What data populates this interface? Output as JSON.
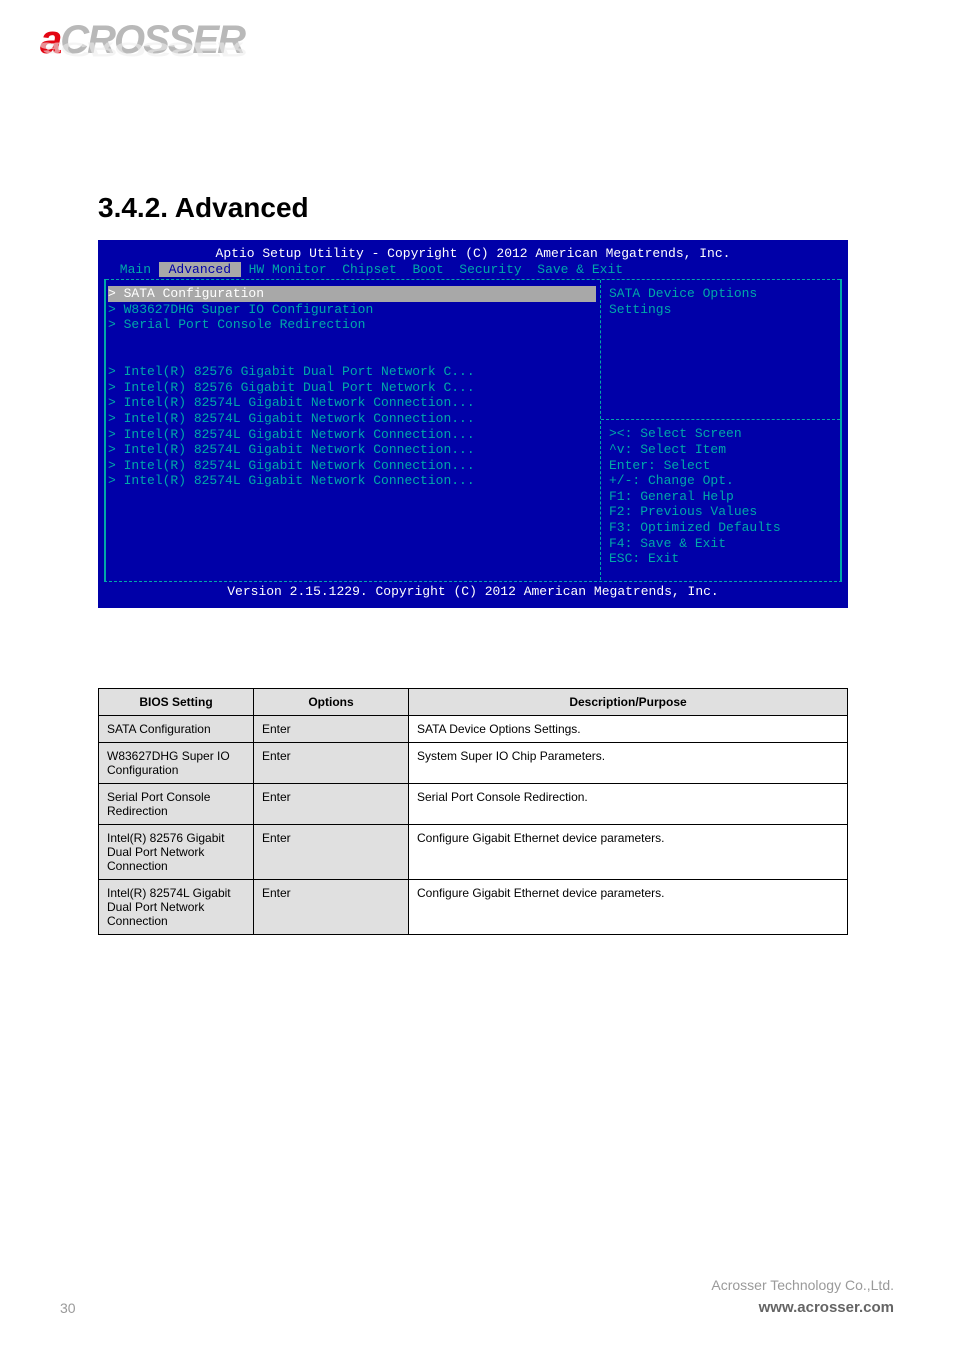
{
  "logo": {
    "a": "a",
    "rest": "CROSSER"
  },
  "section_title": "3.4.2. Advanced",
  "bios": {
    "title": "Aptio Setup Utility - Copyright (C) 2012 American Megatrends, Inc.",
    "tabs": {
      "pre": " Main ",
      "sel": " Advanced ",
      "post": " HW Monitor  Chipset  Boot  Security  Save & Exit"
    },
    "menu": [
      {
        "text": "> SATA Configuration",
        "sel": true
      },
      {
        "text": "> W83627DHG Super IO Configuration",
        "sel": false
      },
      {
        "text": "> Serial Port Console Redirection",
        "sel": false
      },
      {
        "text": "",
        "sel": false
      },
      {
        "text": "",
        "sel": false
      },
      {
        "text": "> Intel(R) 82576 Gigabit Dual Port Network C...",
        "sel": false
      },
      {
        "text": "> Intel(R) 82576 Gigabit Dual Port Network C...",
        "sel": false
      },
      {
        "text": "> Intel(R) 82574L Gigabit Network Connection...",
        "sel": false
      },
      {
        "text": "> Intel(R) 82574L Gigabit Network Connection...",
        "sel": false
      },
      {
        "text": "> Intel(R) 82574L Gigabit Network Connection...",
        "sel": false
      },
      {
        "text": "> Intel(R) 82574L Gigabit Network Connection...",
        "sel": false
      },
      {
        "text": "> Intel(R) 82574L Gigabit Network Connection...",
        "sel": false
      },
      {
        "text": "> Intel(R) 82574L Gigabit Network Connection...",
        "sel": false
      }
    ],
    "help_top": "SATA Device Options\nSettings",
    "help_keys": "><: Select Screen\n^v: Select Item\nEnter: Select\n+/-: Change Opt.\nF1: General Help\nF2: Previous Values\nF3: Optimized Defaults\nF4: Save & Exit\nESC: Exit",
    "footer": "Version 2.15.1229. Copyright (C) 2012 American Megatrends, Inc."
  },
  "table": {
    "headers": [
      "BIOS Setting",
      "Options",
      "Description/Purpose"
    ],
    "rows": [
      [
        "SATA Configuration",
        "Enter",
        "SATA Device Options Settings."
      ],
      [
        "W83627DHG Super IO Configuration",
        "Enter",
        "System Super IO Chip Parameters."
      ],
      [
        "Serial Port Console Redirection",
        "Enter",
        "Serial Port Console Redirection."
      ],
      [
        "Intel(R) 82576 Gigabit Dual Port Network Connection",
        "Enter",
        "Configure Gigabit Ethernet device parameters."
      ],
      [
        "Intel(R) 82574L Gigabit Dual Port Network Connection",
        "Enter",
        "Configure Gigabit Ethernet device parameters."
      ]
    ]
  },
  "footer": {
    "company": "Acrosser Technology Co.,Ltd.",
    "url": "www.acrosser.com"
  },
  "page": "30"
}
